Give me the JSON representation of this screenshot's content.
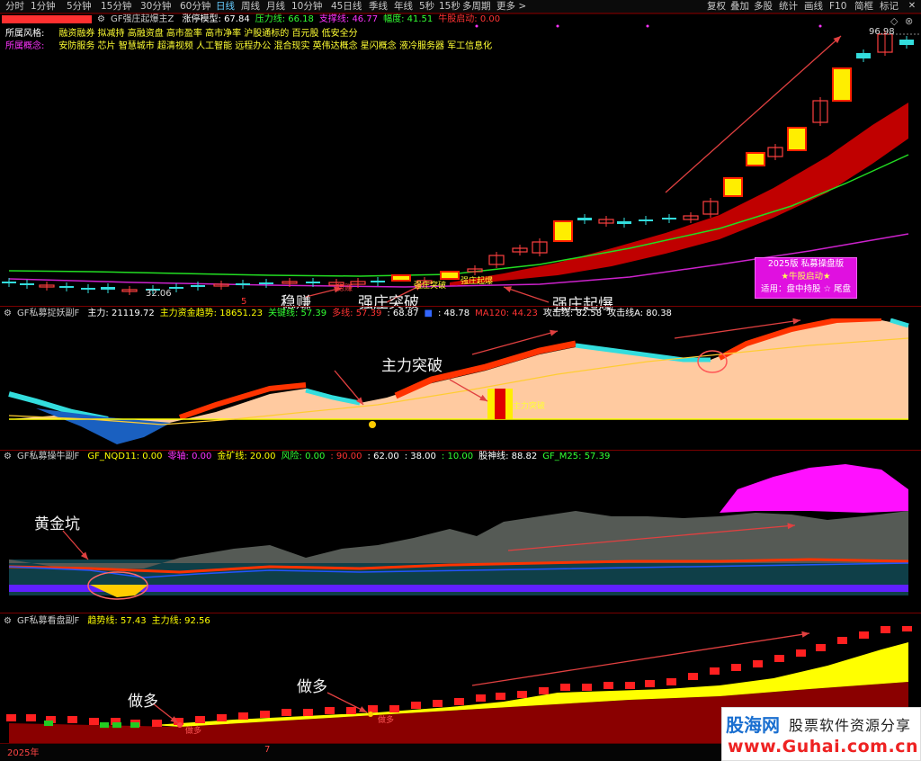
{
  "toolbar": {
    "periods": [
      "分时",
      "1分钟",
      "5分钟",
      "15分钟",
      "30分钟",
      "60分钟",
      "日线",
      "周线",
      "月线",
      "10分钟",
      "45日线",
      "季线",
      "年线",
      "5秒",
      "15秒",
      "多周期",
      "更多 >"
    ],
    "active_period": "日线",
    "right_buttons": [
      "复权",
      "叠加",
      "多股",
      "统计",
      "画线",
      "F10",
      "简框",
      "标记"
    ]
  },
  "main_panel": {
    "indicator_name": "GF强庄起爆主Z",
    "stats": [
      {
        "label": "涨停模型:",
        "value": "67.84",
        "color": "#ffffff"
      },
      {
        "label": "压力线:",
        "value": "66.18",
        "color": "#33ff33"
      },
      {
        "label": "支撑线:",
        "value": "46.77",
        "color": "#ff33ff"
      },
      {
        "label": "幅度:",
        "value": "41.51",
        "color": "#33ff33"
      },
      {
        "label": "牛股启动:",
        "value": "0.00",
        "color": "#ff3333"
      }
    ],
    "style_label": "所属风格:",
    "style_value": "融资融券 拟减持 高融资盘 高市盈率 高市净率 沪股通标的 百元股 低安全分",
    "concept_label": "所属概念:",
    "concept_value": "安防服务 芯片 智慧城市 超清视频 人工智能 远程办公 混合现实 英伟达概念 星闪概念 液冷服务器 军工信息化",
    "price_high": "96.98",
    "price_low": "32.06",
    "marker_5": "5",
    "candle_labels": [
      "稳赚",
      "强庄突破",
      "强庄起爆"
    ],
    "annotations": [
      "稳赚",
      "强庄突破",
      "强庄起爆"
    ],
    "infobox": {
      "line1": "2025版 私募操盘版",
      "line2": "★牛股启动★",
      "line3": "适用：盘中持股 ☆ 尾盘"
    }
  },
  "panel2": {
    "indicator_name": "GF私募捉妖副F",
    "stats": [
      {
        "label": "主力:",
        "value": "21119.72",
        "color": "#ffffff"
      },
      {
        "label": "主力资金趋势:",
        "value": "18651.23",
        "color": "#ffff00"
      },
      {
        "label": "关键线:",
        "value": "57.39",
        "color": "#33ff33"
      },
      {
        "label": "多线:",
        "value": "57.39",
        "color": "#ff3333"
      },
      {
        "label": ":",
        "value": "68.87",
        "color": "#ffffff"
      },
      {
        "label": "",
        "value": "",
        "color": "#3366ff"
      },
      {
        "label": ":",
        "value": "48.78",
        "color": "#ffffff"
      },
      {
        "label": "MA120:",
        "value": "44.23",
        "color": "#ff3333"
      },
      {
        "label": "攻击线:",
        "value": "82.58",
        "color": "#ffffff"
      },
      {
        "label": "攻击线A:",
        "value": "80.38",
        "color": "#ffffff"
      }
    ],
    "annotation": "主力突破",
    "bar_label": "主力突破"
  },
  "panel3": {
    "indicator_name": "GF私募操牛副F",
    "stats": [
      {
        "label": "GF_NQD11:",
        "value": "0.00",
        "color": "#ffff00"
      },
      {
        "label": "零轴:",
        "value": "0.00",
        "color": "#ff33ff"
      },
      {
        "label": "金矿线:",
        "value": "20.00",
        "color": "#ffff00"
      },
      {
        "label": "风险:",
        "value": "0.00",
        "color": "#33ff33"
      },
      {
        "label": ":",
        "value": "90.00",
        "color": "#ff3333"
      },
      {
        "label": ":",
        "value": "62.00",
        "color": "#ffffff"
      },
      {
        "label": ":",
        "value": "38.00",
        "color": "#ffffff"
      },
      {
        "label": ":",
        "value": "10.00",
        "color": "#33ff33"
      },
      {
        "label": "股神线:",
        "value": "88.82",
        "color": "#ffffff"
      },
      {
        "label": "GF_M25:",
        "value": "57.39",
        "color": "#33ff33"
      }
    ],
    "annotation": "黄金坑"
  },
  "panel4": {
    "indicator_name": "GF私募看盘副F",
    "stats": [
      {
        "label": "趋势线:",
        "value": "57.43",
        "color": "#ffff00"
      },
      {
        "label": "主力线:",
        "value": "92.56",
        "color": "#ffff00"
      }
    ],
    "annotations": [
      "做多",
      "做多"
    ],
    "signal_labels": [
      "做多",
      "做多"
    ]
  },
  "footer": {
    "year": "2025年",
    "marker": "7"
  },
  "watermark": {
    "brand": "股海网",
    "slogan": "股票软件资源分享",
    "url": "www.Guhai.com.cn"
  },
  "colors": {
    "up": "#ff3333",
    "down": "#00ffff",
    "accent_red": "#e00000",
    "grid": "#7a0000"
  }
}
